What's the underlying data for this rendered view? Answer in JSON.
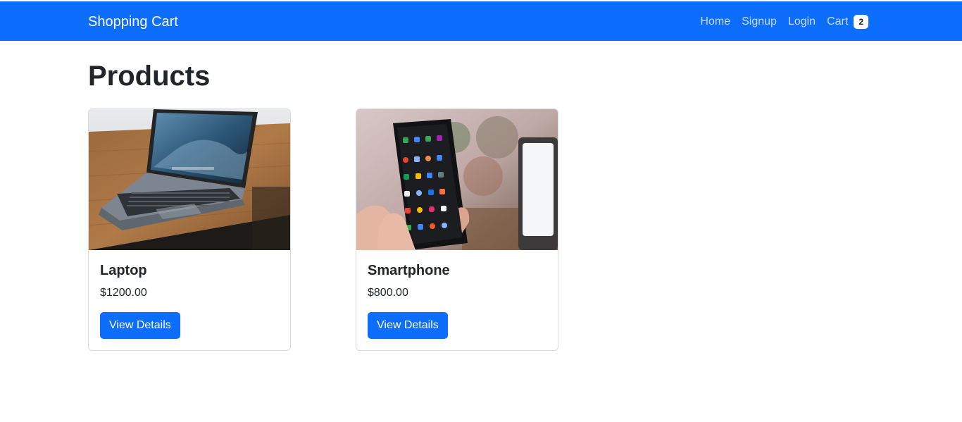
{
  "navbar": {
    "brand": "Shopping Cart",
    "links": [
      "Home",
      "Signup",
      "Login"
    ],
    "cart_label": "Cart",
    "cart_count": "2",
    "bg_color": "#0d6efd"
  },
  "main": {
    "title": "Products"
  },
  "products": [
    {
      "name": "Laptop",
      "price": "$1200.00",
      "button_label": "View Details",
      "image": "laptop-photo"
    },
    {
      "name": "Smartphone",
      "price": "$800.00",
      "button_label": "View Details",
      "image": "smartphone-photo"
    }
  ]
}
